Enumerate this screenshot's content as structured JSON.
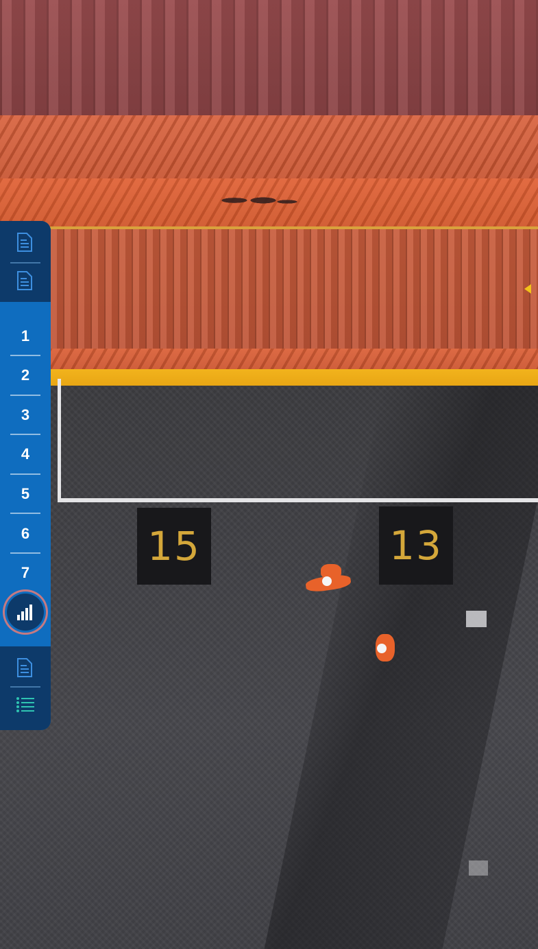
{
  "bays": {
    "left": "15",
    "right": "13"
  },
  "sidebar": {
    "top_items": [
      {
        "icon": "document-icon"
      },
      {
        "icon": "document-icon"
      }
    ],
    "numbered_items": [
      {
        "label": "1"
      },
      {
        "label": "2"
      },
      {
        "label": "3"
      },
      {
        "label": "4"
      },
      {
        "label": "5"
      },
      {
        "label": "6"
      },
      {
        "label": "7"
      }
    ],
    "active_item": {
      "icon": "bar-chart-icon"
    },
    "bottom_items": [
      {
        "icon": "document-icon"
      },
      {
        "icon": "list-icon"
      }
    ]
  },
  "colors": {
    "nav_blue": "#0f6dbf",
    "nav_dark": "#0d3a6a",
    "active_ring": "#c57a82",
    "bay_number": "#d4a73a"
  }
}
